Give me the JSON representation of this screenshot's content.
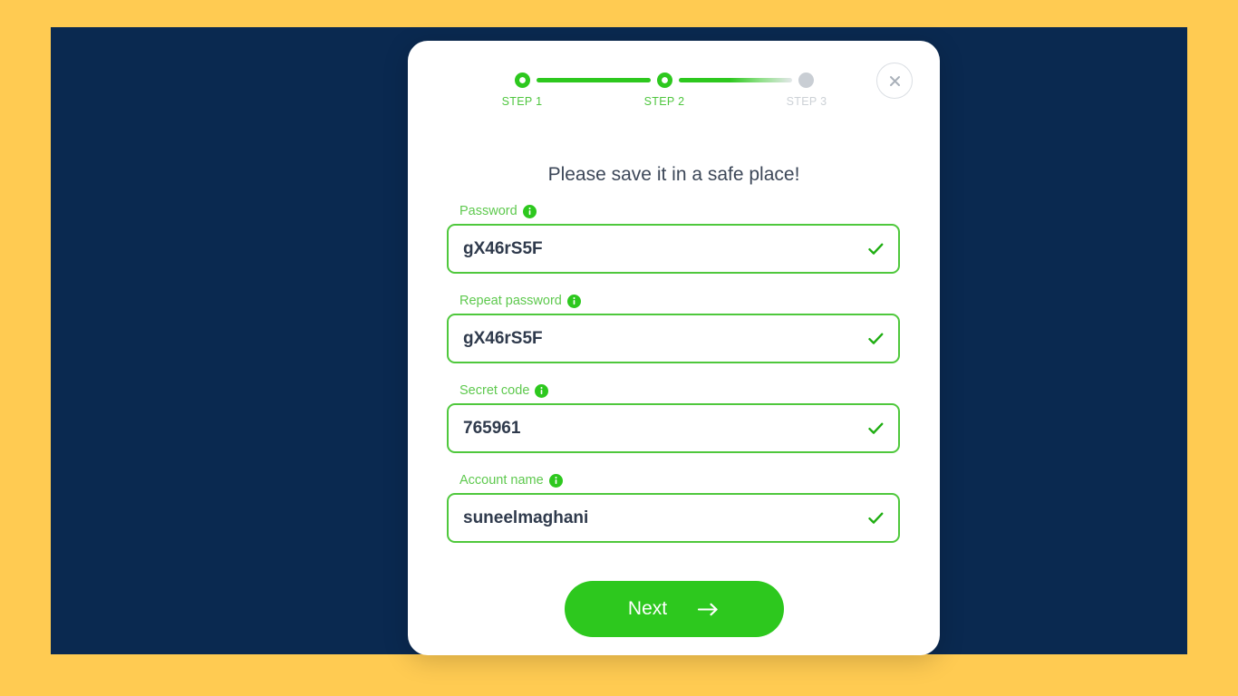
{
  "theme": {
    "frame_color": "#FFCB52",
    "stage_color": "#0A2950",
    "card_color": "#FFFFFF",
    "accent_green": "#2DC81E",
    "label_green": "#5EC94E",
    "muted_gray": "#C9CED4",
    "title_color": "#3C4758",
    "value_color": "#2F3A4C"
  },
  "modal": {
    "close_icon": "close-icon",
    "close_label": "Close",
    "title": "Please save it in a safe place!"
  },
  "stepper": {
    "current_step": 2,
    "steps": [
      {
        "label": "STEP 1",
        "state": "done"
      },
      {
        "label": "STEP 2",
        "state": "done"
      },
      {
        "label": "STEP 3",
        "state": "todo"
      }
    ]
  },
  "form": {
    "fields": [
      {
        "label": "Password",
        "info_icon": "info-icon",
        "value": "gX46rS5F",
        "placeholder": "Password",
        "valid": true,
        "valid_icon": "check-icon"
      },
      {
        "label": "Repeat password",
        "info_icon": "info-icon",
        "value": "gX46rS5F",
        "placeholder": "Repeat password",
        "valid": true,
        "valid_icon": "check-icon"
      },
      {
        "label": "Secret code",
        "info_icon": "info-icon",
        "value": "765961",
        "placeholder": "Secret code",
        "valid": true,
        "valid_icon": "check-icon"
      },
      {
        "label": "Account name",
        "info_icon": "info-icon",
        "value": "suneelmaghani",
        "placeholder": "Account name",
        "valid": true,
        "valid_icon": "check-icon"
      }
    ]
  },
  "footer": {
    "next_label": "Next",
    "next_icon": "arrow-right-icon"
  }
}
